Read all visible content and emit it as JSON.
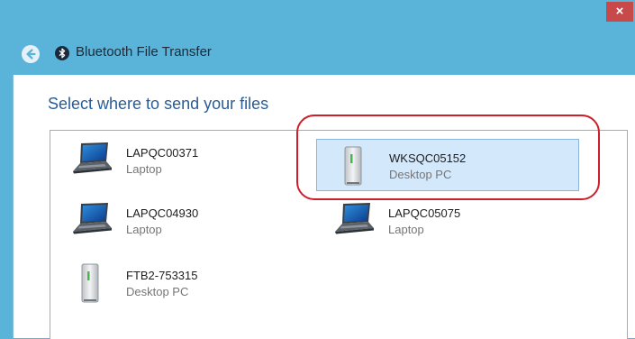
{
  "window": {
    "close_label": "×"
  },
  "header": {
    "title": "Bluetooth File Transfer",
    "back_icon": "back-arrow-icon",
    "bluetooth_icon": "bluetooth-icon"
  },
  "main": {
    "heading": "Select where to send your files",
    "devices": [
      {
        "name": "LAPQC00371",
        "type": "Laptop",
        "icon": "laptop-icon",
        "selected": false
      },
      {
        "name": "WKSQC05152",
        "type": "Desktop PC",
        "icon": "desktop-pc-icon",
        "selected": true
      },
      {
        "name": "LAPQC04930",
        "type": "Laptop",
        "icon": "laptop-icon",
        "selected": false
      },
      {
        "name": "LAPQC05075",
        "type": "Laptop",
        "icon": "laptop-icon",
        "selected": false
      },
      {
        "name": "FTB2-753315",
        "type": "Desktop PC",
        "icon": "desktop-pc-icon",
        "selected": false
      }
    ]
  },
  "colors": {
    "chrome": "#5ab3d8",
    "close": "#c7494a",
    "heading": "#2a5c95",
    "selection": "#d4e8fb",
    "annotation_ring": "#cc1f29"
  }
}
